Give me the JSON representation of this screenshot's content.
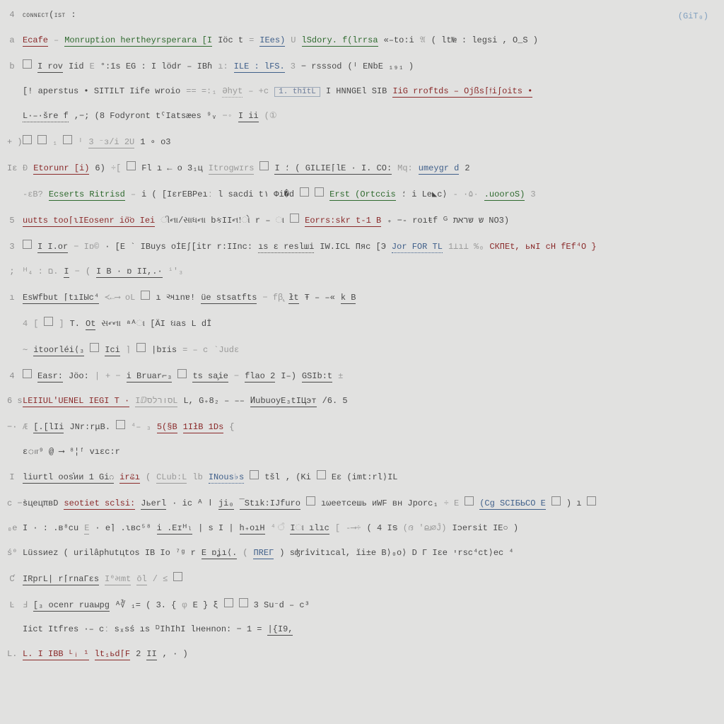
{
  "header": {
    "title": "connect(ist :",
    "ai": "4",
    "creditTop": "(GiT₀)"
  },
  "rows": [
    {
      "g": "a",
      "parts": [
        {
          "t": "Ecafe",
          "c": "red",
          "u": 1
        },
        {
          "t": "–",
          "c": "sep"
        },
        {
          "t": "Monruption hertheyrsperara [I",
          "c": "grn",
          "u": 1
        },
        {
          "t": "Iöc  t",
          "c": "drk"
        },
        {
          "t": "=",
          "c": "sep"
        },
        {
          "t": "IEes)",
          "c": "blu",
          "u": 1
        },
        {
          "t": " U",
          "c": "gry"
        },
        {
          "t": "lSdory. f(lrrsa",
          "c": "grn",
          "u": 1
        },
        {
          "t": "«–to:i",
          "c": "drk"
        },
        {
          "t": " 𝔄",
          "c": "gry"
        },
        {
          "t": "( lt№ :  legsi , O_S )",
          "c": "drk"
        }
      ]
    },
    {
      "g": "b",
      "parts": [
        {
          "box": 1
        },
        {
          "t": "I rov",
          "c": "drk",
          "u": 1
        },
        {
          "t": "  Iid",
          "c": "drk"
        },
        {
          "t": "E",
          "c": "sep"
        },
        {
          "t": "°:īs   EG : I lödr – IBɦ",
          "c": "drk"
        },
        {
          "t": "ı:",
          "c": "sep"
        },
        {
          "t": "ILE : lFS.",
          "c": "blu",
          "u": 1
        },
        {
          "t": "3",
          "c": "gry"
        },
        {
          "t": " − rsssod",
          "c": "drk"
        },
        {
          "t": "  (ᴵ  ENbE ₁₉₁ )",
          "c": "drk"
        }
      ]
    },
    {
      "g": "",
      "parts": [
        {
          "t": "[! aperstus •  SITILT Iife wroio",
          "c": "drk"
        },
        {
          "t": "==  =:₁",
          "c": "sep"
        },
        {
          "t": "Əhyt",
          "c": "gry",
          "du": 1
        },
        {
          "t": "–  +c",
          "c": "sep"
        },
        {
          "boxw": "1. thītL"
        },
        {
          "t": "  I HNNGEl     SIB",
          "c": "drk"
        },
        {
          "t": "IiG  rroftds – Ojßs⌈𝔣iʃoits •",
          "c": "red",
          "u": 1
        }
      ]
    },
    {
      "g": "",
      "parts": [
        {
          "t": "L·–·šre  f",
          "c": "drk",
          "du": 1
        },
        {
          "t": ",−;    (8 Fodyront tˁIatsæes ⁹ᵥ",
          "c": "drk"
        },
        {
          "t": "−◦",
          "c": "sep"
        },
        {
          "t": "I ii",
          "c": "drk",
          "u": 1
        },
        {
          "t": "(①",
          "c": "gry"
        }
      ]
    },
    {
      "g": "+ )",
      "parts": [
        {
          "box": 1
        },
        {
          "box": 1
        },
        {
          "t": "₁",
          "c": "gry"
        },
        {
          "box": 1
        },
        {
          "t": "ᴵ",
          "c": "gry"
        },
        {
          "t": "3 ⁻ɜ/i   2U",
          "c": "gry",
          "u": 1
        },
        {
          "t": "1     ∘ o3",
          "c": "drk"
        }
      ]
    },
    {
      "g": "Iɛ",
      "parts": [
        {
          "t": "Đ",
          "c": "gry"
        },
        {
          "t": "Etorunr [i)",
          "c": "red",
          "u": 1
        },
        {
          "t": "6)",
          "c": "drk"
        },
        {
          "t": "÷[",
          "c": "sep"
        },
        {
          "box": 1
        },
        {
          "t": "Fl ı ← o  3₁ц",
          "c": "drk"
        },
        {
          "t": "Itrogwɪrs",
          "c": "gry",
          "u": 1
        },
        {
          "box": 1
        },
        {
          "t": " I  ؛  ( GILIE⌈lE   ·   I.  CO:",
          "c": "drk",
          "u": 1
        },
        {
          "t": "Mq:",
          "c": "gry"
        },
        {
          "t": "umeygr d",
          "c": "blu",
          "u": 1
        },
        {
          "t": "2",
          "c": "drk"
        }
      ]
    },
    {
      "g": "",
      "parts": [
        {
          "t": "-ɛB?",
          "c": "gry"
        },
        {
          "t": "Ecserts Ritrisd",
          "c": "grn",
          "u": 1
        },
        {
          "t": "–",
          "c": "sep"
        },
        {
          "t": "i ( [IɛrEBPeıː l    sacdi t۱   Φi�d",
          "c": "drk"
        },
        {
          "box": 1
        },
        {
          "box": 1
        },
        {
          "t": "Erst  (Ortccis",
          "c": "grn",
          "u": 1
        },
        {
          "t": "؛   i Le◣c⟩",
          "c": "drk"
        },
        {
          "t": "-   ·۵۰",
          "c": "gry"
        },
        {
          "t": "    .uooroS)",
          "c": "grn",
          "u": 1
        },
        {
          "t": "3",
          "c": "gry"
        }
      ]
    },
    {
      "g": "5",
      "parts": [
        {
          "t": "uutts too⌈ιIEosenr iö̈o  Iei",
          "c": "red",
          "u": 1
        },
        {
          "t": "ીના/સાધના  bકIIન!ો   r  – ા",
          "c": "drk"
        },
        {
          "box": 1
        },
        {
          "t": "Eorrs:skr t-1 B",
          "c": "red",
          "u": 1
        },
        {
          "t": "₊   −- roıŧf     ᴳ ש    שראת NO3)",
          "c": "drk"
        }
      ]
    },
    {
      "g": "3",
      "parts": [
        {
          "box": 1
        },
        {
          "t": "I I.or",
          "c": "drk",
          "u": 1
        },
        {
          "t": "−   Iɒ©",
          "c": "sep"
        },
        {
          "t": " · [E ` IBuys oİEʃ[itr r:IInc:",
          "c": "drk"
        },
        {
          "t": "ıs    ɛ  reslші",
          "c": "drk",
          "du": 1
        },
        {
          "t": "IW.ICL   Пяс  [Э",
          "c": "drk"
        },
        {
          "t": "Jor FOR  TL",
          "c": "blu",
          "du": 1
        },
        {
          "t": "1⊥ı⊥ %₀",
          "c": "gry"
        },
        {
          "t": "СКПЕt, ьɴI сH fEf⁴O  }",
          "c": "red"
        }
      ]
    },
    {
      "g": ";",
      "parts": [
        {
          "t": "ᴴ₄ :  ם.",
          "c": "gry"
        },
        {
          "t": "I",
          "c": "drk",
          "u": 1
        },
        {
          "t": "−",
          "c": "sep"
        },
        {
          "t": "(",
          "c": "paren"
        },
        {
          "t": "  I B ·  ɒ   II,.·",
          "c": "drk",
          "u": 1
        },
        {
          "t": "ⁱ'₃",
          "c": "gry"
        }
      ]
    },
    {
      "g": "ı",
      "parts": [
        {
          "t": "EsWfbut ⌈tıIЫc⁴",
          "c": "drk",
          "u": 1
        },
        {
          "t": "≺←⟶  oL",
          "c": "sep"
        },
        {
          "box": 1
        },
        {
          "t": "ı અınɐ!",
          "c": "drk"
        },
        {
          "t": "üe stsatfts",
          "c": "drk",
          "u": 1
        },
        {
          "t": "−  fβ̢",
          "c": "sep"
        },
        {
          "t": "łt",
          "c": "drk",
          "u": 1
        },
        {
          "t": "  Ŧ – –«",
          "c": "drk"
        },
        {
          "t": "k B",
          "c": "drk",
          "u": 1
        }
      ]
    },
    {
      "g": "",
      "parts": [
        {
          "t": "   4",
          "c": "gry"
        },
        {
          "t": "[",
          "c": "sep"
        },
        {
          "box": 1
        },
        {
          "t": "]",
          "c": "sep"
        },
        {
          "t": "T.",
          "c": "drk"
        },
        {
          "t": "Ot",
          "c": "drk",
          "u": 1
        },
        {
          "t": "સન્ના ᵃᴬા [ÄI     ઘas   L     dĪ",
          "c": "drk"
        }
      ]
    },
    {
      "g": "",
      "parts": [
        {
          "t": "     ∼",
          "c": "sep"
        },
        {
          "t": "itoorléi⟨₃",
          "c": "drk",
          "u": 1
        },
        {
          "box": 1
        },
        {
          "t": "Ici",
          "c": "drk",
          "u": 1
        },
        {
          "t": " ⌉",
          "c": "sep"
        },
        {
          "box": 1
        },
        {
          "t": "|bɪis",
          "c": "drk"
        },
        {
          "t": "=    –  c",
          "c": "sep"
        },
        {
          "t": "`Judɛ",
          "c": "gry"
        }
      ]
    },
    {
      "g": "4",
      "parts": [
        {
          "box": 1
        },
        {
          "t": "Easr:",
          "c": "drk",
          "u": 1
        },
        {
          "t": "    Jöo:",
          "c": "drk"
        },
        {
          "t": "|",
          "c": "sep"
        },
        {
          "t": "+ −",
          "c": "sep"
        },
        {
          "t": "i Bruar⌐₃",
          "c": "drk",
          "u": 1
        },
        {
          "box": 1
        },
        {
          "t": "ts    sa̧ie",
          "c": "drk",
          "u": 1
        },
        {
          "t": "  −",
          "c": "sep"
        },
        {
          "t": "flao   2",
          "c": "drk",
          "u": 1
        },
        {
          "t": "  I–)",
          "c": "drk"
        },
        {
          "t": "GSIb:t",
          "c": "drk",
          "u": 1
        },
        {
          "t": "±",
          "c": "sep"
        }
      ]
    },
    {
      "g": "6 s",
      "parts": [
        {
          "t": " LEIIUL'UENEL   IEGI T ·",
          "c": "red",
          "u": 1
        },
        {
          "t": "   IⅅסורלסL",
          "c": "gry",
          "u": 1
        },
        {
          "t": "L, G₊8₂ – ––",
          "c": "drk"
        },
        {
          "t": "ͶubuoyE₃tIЦэт",
          "c": "drk",
          "u": 1
        },
        {
          "t": "/6. 5",
          "c": "drk"
        }
      ]
    },
    {
      "g": "−·",
      "parts": [
        {
          "t": "Æ",
          "c": "gry"
        },
        {
          "t": "[.[lIi",
          "c": "drk",
          "u": 1
        },
        {
          "t": "  JNr:rμB.",
          "c": "drk"
        },
        {
          "box": 1
        },
        {
          "t": "⁴–  ₃",
          "c": "sep"
        },
        {
          "t": "5(§B",
          "c": "red",
          "u": 1
        },
        {
          "t": "1IłB 1Ds",
          "c": "red",
          "u": 1
        },
        {
          "t": " {",
          "c": "paren"
        }
      ]
    },
    {
      "g": "",
      "parts": [
        {
          "t": "ɛா⁹   @ ⟶ ⁸¦ᶠ    vıɛc:r",
          "c": "drk"
        }
      ]
    },
    {
      "g": "I",
      "parts": [
        {
          "t": "liurtl oos̊ии 1 Gi೧",
          "c": "drk",
          "u": 1
        },
        {
          "t": "irଌı",
          "c": "red",
          "u": 1
        },
        {
          "t": "(",
          "c": "paren"
        },
        {
          "t": "CLub:L",
          "c": "gry",
          "u": 1
        },
        {
          "t": "       lb",
          "c": "gry"
        },
        {
          "t": "INous♭s",
          "c": "blu",
          "du": 1
        },
        {
          "box": 1
        },
        {
          "t": "tšl",
          "c": "drk"
        },
        {
          "t": ",    (Ki",
          "c": "drk"
        },
        {
          "box": 1
        },
        {
          "t": "  Eɛ       (imt:rl⟩IL",
          "c": "drk"
        }
      ]
    },
    {
      "g": "c −ˡ",
      "parts": [
        {
          "t": "sцецπвD",
          "c": "drk"
        },
        {
          "t": "seotiet sclsi:",
          "c": "red",
          "u": 1
        },
        {
          "t": "Jьerl",
          "c": "drk",
          "u": 1
        },
        {
          "t": "· ic  ᴬ ا",
          "c": "drk"
        },
        {
          "t": "ji₀",
          "c": "drk",
          "u": 1
        },
        {
          "t": "¯Stık:IJfuro",
          "c": "drk",
          "u": 1
        },
        {
          "box": 1
        },
        {
          "t": "ıωеетсешь    иWF вн   Jроrс₁",
          "c": "drk"
        },
        {
          "t": "÷    E",
          "c": "sep"
        },
        {
          "box": 1
        },
        {
          "t": "(Cg  SCIБЬСО E",
          "c": "blu",
          "u": 1
        },
        {
          "box": 1
        },
        {
          "t": ")   ı",
          "c": "drk"
        },
        {
          "box": 1
        }
      ]
    },
    {
      "g": "₀e",
      "parts": [
        {
          "t": "I · :   .в⁸cu",
          "c": "drk"
        },
        {
          "t": "E",
          "c": "gry",
          "u": 1
        },
        {
          "t": "· е⌉ .ιвс⁵⁸",
          "c": "drk"
        },
        {
          "t": "i .Εɪᴴₗ",
          "c": "drk",
          "u": 1
        },
        {
          "t": "|  s     I  |",
          "c": "drk"
        },
        {
          "t": "h₊oıH",
          "c": "drk",
          "u": 1
        },
        {
          "t": "⁴ ੰ",
          "c": "gry"
        },
        {
          "t": "Iା ılıc",
          "c": "drk",
          "u": 1
        },
        {
          "t": "[",
          "c": "sep"
        },
        {
          "t": "-⟶÷",
          "c": "sep"
        },
        {
          "t": "  (  4   Iട",
          "c": "drk"
        },
        {
          "t": "(ദ",
          "c": "sep"
        },
        {
          "t": "'ല∅Ĵ)",
          "c": "gry"
        },
        {
          "t": "     Iɔersit   IE○ )",
          "c": "drk"
        }
      ]
    },
    {
      "g": "ś⁰",
      "parts": [
        {
          "t": "Lüssиez  (   urilâphutцtos IB  Io     ⁷ᵍ      r",
          "c": "drk"
        },
        {
          "t": "E  ɒʝı⟨.",
          "c": "drk",
          "u": 1
        },
        {
          "t": "(",
          "c": "paren"
        },
        {
          "t": "ПREΓ",
          "c": "blu",
          "u": 1
        },
        {
          "t": ")   sʤrỉvitıcal,     ĭi±e B⟩₀o⟩     D   Γ  Iɛe    יrsc⁴ct⟩ec ⁴",
          "c": "drk"
        }
      ]
    },
    {
      "g": "Ƈ",
      "parts": [
        {
          "t": "IRpгL| r⌈rnaГɛs",
          "c": "drk",
          "u": 1
        },
        {
          "t": "I⁰મmt",
          "c": "gry",
          "u": 1
        },
        {
          "t": "  ōl",
          "c": "gry",
          "u": 1
        },
        {
          "t": "/ ≤",
          "c": "sep"
        },
        {
          "box": 1
        }
      ]
    },
    {
      "g": "Ŀ",
      "parts": [
        {
          "t": "Ⅎ",
          "c": "gry"
        },
        {
          "t": "[₃  οcenr ruaырg",
          "c": "drk",
          "u": 1
        },
        {
          "t": "ᴬ∛    ₁=      (  3.  {",
          "c": "drk"
        },
        {
          "t": " φ",
          "c": "gry"
        },
        {
          "t": "E   } ξ",
          "c": "drk"
        },
        {
          "box": 1
        },
        {
          "box": 1
        },
        {
          "t": "     3 Su⁻d – c³",
          "c": "drk"
        }
      ]
    },
    {
      "g": "",
      "parts": [
        {
          "t": "Iict  Itfres ·– cː sₓsś ıs   ᴰIhIhI lненnon:    − 1 =",
          "c": "drk"
        },
        {
          "t": "|{I9,",
          "c": "drk",
          "u": 1
        }
      ]
    },
    {
      "g": "L.",
      "parts": [
        {
          "t": "L. I IBB ᴸᵢ ¹",
          "c": "red",
          "u": 1
        },
        {
          "t": "lt₁ьd⌈F",
          "c": "red",
          "u": 1
        },
        {
          "t": "         2",
          "c": "drk"
        },
        {
          "t": "  II",
          "c": "drk",
          "u": 1
        },
        {
          "t": "  ,   ·  )",
          "c": "drk"
        }
      ]
    }
  ]
}
